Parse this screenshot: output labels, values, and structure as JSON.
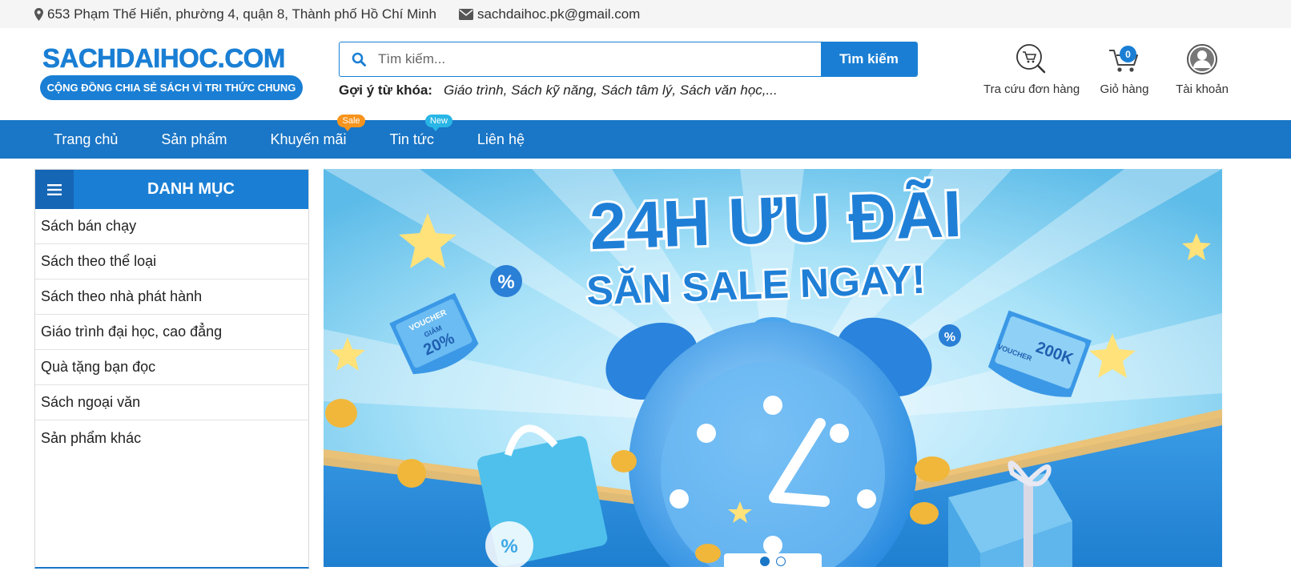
{
  "topbar": {
    "address": "653 Phạm Thế Hiển, phường 4, quận 8, Thành phố Hồ Chí Minh",
    "email": "sachdaihoc.pk@gmail.com",
    "address_icon": "map-marker-icon",
    "email_icon": "envelope-icon"
  },
  "header": {
    "logo_text": "SACHDAIHOC.COM",
    "logo_slogan": "CỘNG ĐỒNG CHIA SẺ SÁCH VÌ TRI THỨC CHUNG",
    "search_placeholder": "Tìm kiếm...",
    "search_button": "Tìm kiếm",
    "suggest_label": "Gợi ý từ khóa:",
    "suggest_keywords": "Giáo trình, Sách kỹ năng, Sách tâm lý, Sách văn học,...",
    "order_lookup": "Tra cứu đơn hàng",
    "cart": "Giỏ hàng",
    "cart_count": "0",
    "account": "Tài khoản"
  },
  "nav": {
    "items": [
      {
        "label": "Trang chủ"
      },
      {
        "label": "Sản phẩm"
      },
      {
        "label": "Khuyến mãi",
        "tag": "Sale"
      },
      {
        "label": "Tin tức",
        "tag": "New"
      },
      {
        "label": "Liên hệ"
      }
    ]
  },
  "sidebar": {
    "title": "DANH MỤC",
    "items": [
      {
        "label": "Sách bán chạy"
      },
      {
        "label": "Sách theo thể loại"
      },
      {
        "label": "Sách theo nhà phát hành"
      },
      {
        "label": "Giáo trình đại học, cao đẳng"
      },
      {
        "label": "Quà tặng bạn đọc"
      },
      {
        "label": "Sách ngoại văn"
      },
      {
        "label": "Sản phẩm khác"
      }
    ]
  },
  "banner": {
    "headline": "24H ƯU ĐÃI",
    "subheadline": "SĂN SALE NGAY!",
    "voucher_left_top": "VOUCHER",
    "voucher_left_mid": "GIẢM",
    "voucher_left_value": "20%",
    "voucher_right_top": "VOUCHER",
    "voucher_right_value": "200K",
    "slides_total": 2,
    "active_slide": 1
  },
  "colors": {
    "brand": "#1a7fd4",
    "nav": "#1a76c6",
    "sale_tag": "#f7941d",
    "new_tag": "#29b6e6"
  }
}
